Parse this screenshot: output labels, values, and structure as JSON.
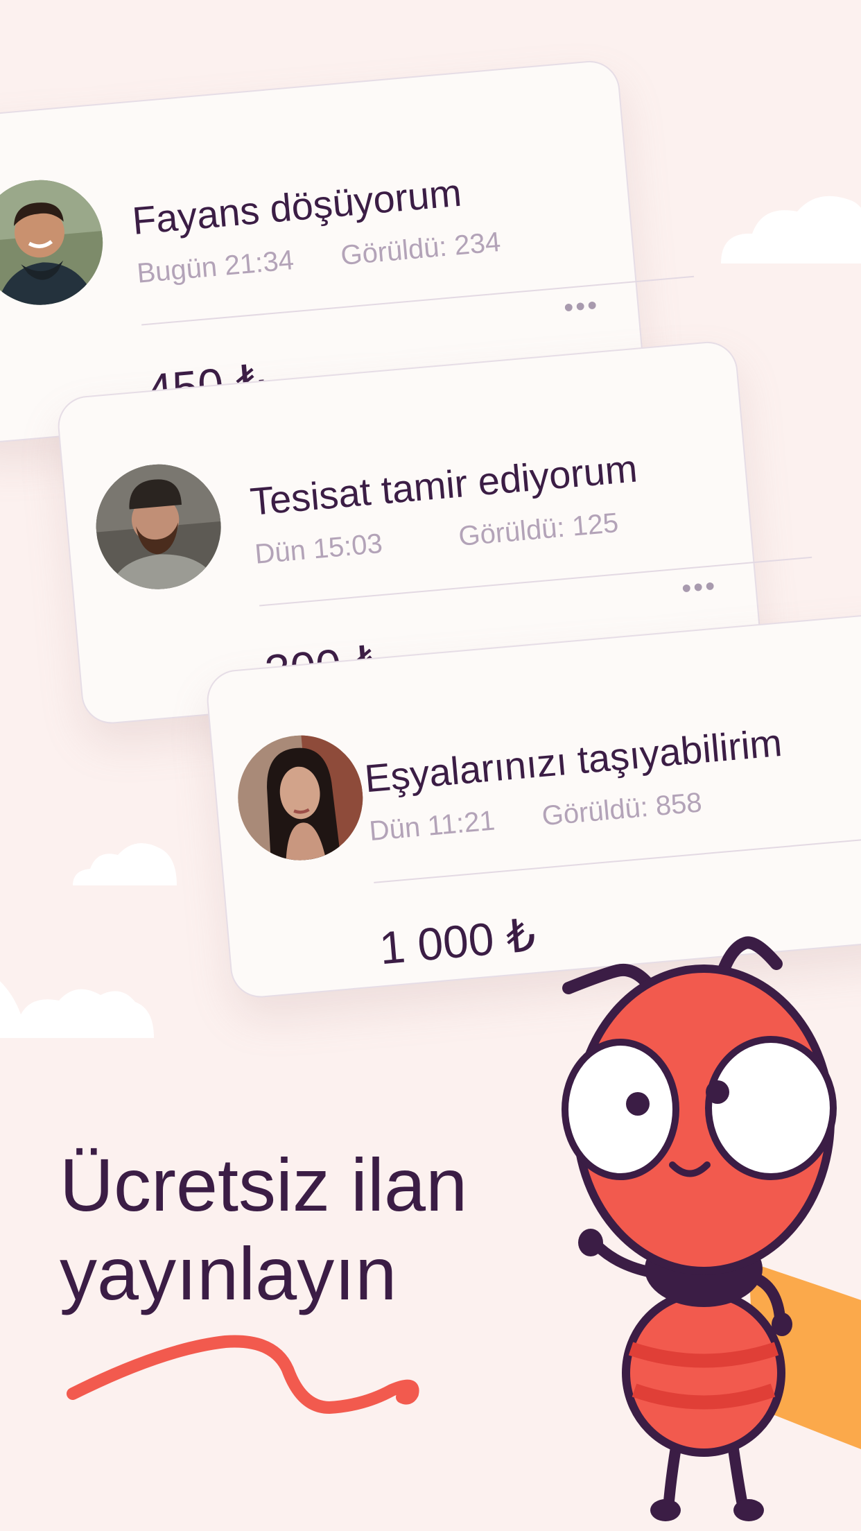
{
  "colors": {
    "background": "#fcf1ef",
    "text_dark": "#3b1d45",
    "text_muted": "#b3a3b8",
    "card": "#fdfaf8",
    "accent_red": "#f25a4e",
    "accent_orange": "#fba94b"
  },
  "listings": [
    {
      "title": "Fayans döşüyorum",
      "date": "Bugün 21:34",
      "views": "Görüldü: 234",
      "price": "450 ₺",
      "more": "•••",
      "avatar_icon": "user-avatar-man-smiling"
    },
    {
      "title": "Tesisat tamir ediyorum",
      "date": "Dün 15:03",
      "views": "Görüldü: 125",
      "price": "300 ₺",
      "more": "•••",
      "avatar_icon": "user-avatar-man-beanie"
    },
    {
      "title": "Eşyalarınızı taşıyabilirim",
      "date": "Dün 11:21",
      "views": "Görüldü: 858",
      "price": "1 000 ₺",
      "more": "•••",
      "avatar_icon": "user-avatar-woman"
    }
  ],
  "headline": {
    "line1": "Ücretsiz ilan",
    "line2": "yayınlayın"
  },
  "mascot_icon": "ant-mascot"
}
